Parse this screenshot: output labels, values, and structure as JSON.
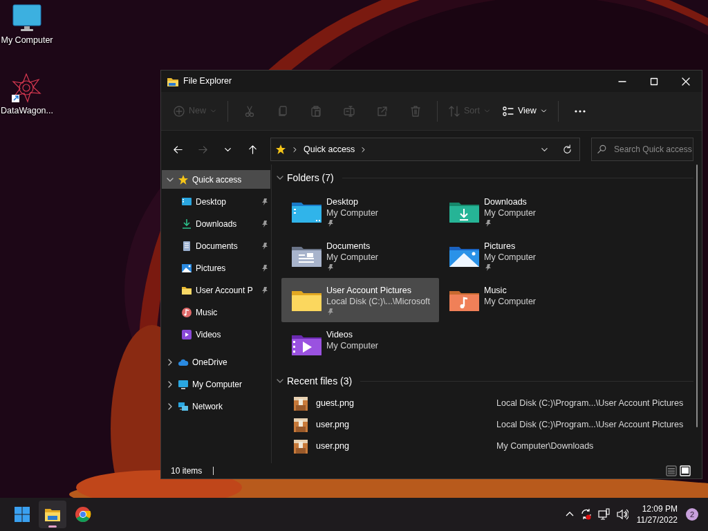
{
  "desktop_icons": [
    {
      "kind": "computer",
      "label": "My Computer"
    },
    {
      "kind": "app",
      "label": "DataWagon..."
    }
  ],
  "window": {
    "title": "File Explorer"
  },
  "toolbar": [
    {
      "kind": "new",
      "label": "New",
      "disabled": true
    },
    {
      "kind": "separator"
    },
    {
      "kind": "cut",
      "disabled": true
    },
    {
      "kind": "copy",
      "disabled": true
    },
    {
      "kind": "paste",
      "disabled": true
    },
    {
      "kind": "rename",
      "disabled": true
    },
    {
      "kind": "share",
      "disabled": true
    },
    {
      "kind": "delete",
      "disabled": true
    },
    {
      "kind": "separator"
    },
    {
      "kind": "sort",
      "label": "Sort",
      "disabled": true
    },
    {
      "kind": "view",
      "label": "View",
      "disabled": false
    },
    {
      "kind": "separator"
    },
    {
      "kind": "more",
      "disabled": false
    }
  ],
  "nav": [
    {
      "kind": "back",
      "disabled": false
    },
    {
      "kind": "forward",
      "disabled": true
    },
    {
      "kind": "recent",
      "disabled": false
    },
    {
      "kind": "up",
      "disabled": false
    }
  ],
  "address": {
    "path": [
      "Quick access"
    ]
  },
  "search": {
    "placeholder": "Search Quick access"
  },
  "sidebar": {
    "items": [
      {
        "kind": "star",
        "label": "Quick access",
        "expanded": true,
        "selected": true,
        "children": [
          {
            "kind": "desktop",
            "label": "Desktop",
            "pinned": true,
            "selected": false
          },
          {
            "kind": "downloads",
            "label": "Downloads",
            "pinned": true,
            "selected": false
          },
          {
            "kind": "documents",
            "label": "Documents",
            "pinned": true,
            "selected": false
          },
          {
            "kind": "pictures",
            "label": "Pictures",
            "pinned": true,
            "selected": false
          },
          {
            "kind": "folder",
            "label": "User Account P",
            "pinned": true,
            "selected": false
          },
          {
            "kind": "music",
            "label": "Music",
            "pinned": false,
            "selected": false
          },
          {
            "kind": "videos",
            "label": "Videos",
            "pinned": false,
            "selected": false
          }
        ]
      },
      {
        "kind": "cloud",
        "label": "OneDrive",
        "expanded": false,
        "selected": false
      },
      {
        "kind": "pc",
        "label": "My Computer",
        "expanded": false,
        "selected": false
      },
      {
        "kind": "network",
        "label": "Network",
        "expanded": false,
        "selected": false
      }
    ]
  },
  "folders": {
    "title": "Folders (7)",
    "expanded": true,
    "items": [
      {
        "kind": "desktop",
        "name": "Desktop",
        "location": "My Computer",
        "pinned": true,
        "selected": false
      },
      {
        "kind": "downloads",
        "name": "Downloads",
        "location": "My Computer",
        "pinned": true,
        "selected": false
      },
      {
        "kind": "documents",
        "name": "Documents",
        "location": "My Computer",
        "pinned": true,
        "selected": false
      },
      {
        "kind": "pictures",
        "name": "Pictures",
        "location": "My Computer",
        "pinned": true,
        "selected": false
      },
      {
        "kind": "folder",
        "name": "User Account Pictures",
        "location": "Local Disk (C:)\\...\\Microsoft",
        "pinned": true,
        "selected": true
      },
      {
        "kind": "music",
        "name": "Music",
        "location": "My Computer",
        "pinned": false,
        "selected": false
      },
      {
        "kind": "videos",
        "name": "Videos",
        "location": "My Computer",
        "pinned": false,
        "selected": false
      }
    ]
  },
  "recent_files": {
    "title": "Recent files (3)",
    "expanded": true,
    "rows": [
      {
        "name": "guest.png",
        "location": "Local Disk (C:)\\Program...\\User Account Pictures"
      },
      {
        "name": "user.png",
        "location": "Local Disk (C:)\\Program...\\User Account Pictures"
      },
      {
        "name": "user.png",
        "location": "My Computer\\Downloads"
      }
    ]
  },
  "status_bar": {
    "count": "10 items"
  },
  "view_modes": [
    {
      "kind": "details",
      "selected": false
    },
    {
      "kind": "tiles",
      "selected": true
    }
  ],
  "taskbar": {
    "apps": [
      {
        "kind": "start",
        "active": false
      },
      {
        "kind": "explorer",
        "active": true
      },
      {
        "kind": "chrome",
        "active": false
      }
    ],
    "time": "12:09 PM",
    "date": "11/27/2022",
    "notifications": "2"
  }
}
